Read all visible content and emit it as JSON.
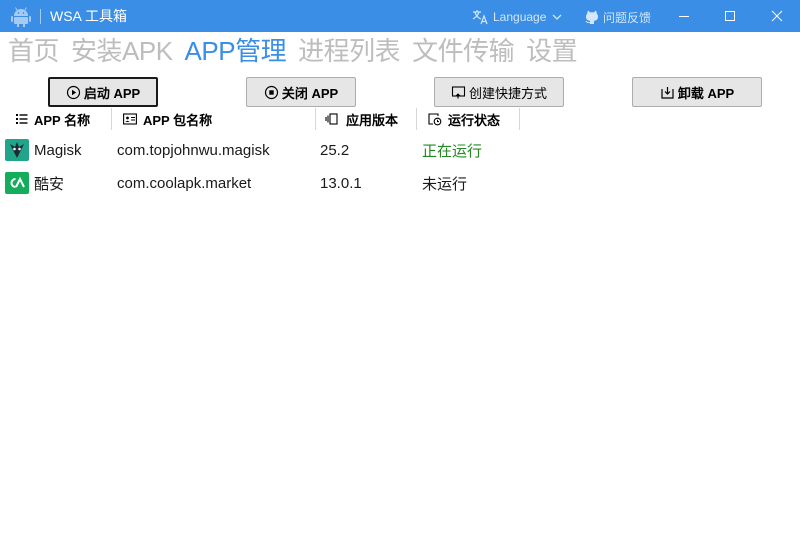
{
  "window": {
    "title": "WSA 工具箱",
    "language_label": "Language",
    "feedback_label": "问题反馈",
    "accent_color": "#3a8ee6"
  },
  "nav": {
    "items": [
      "首页",
      "安装APK",
      "APP管理",
      "进程列表",
      "文件传输",
      "设置"
    ],
    "active": "APP管理"
  },
  "toolbar": {
    "start_label": "启动 APP",
    "close_label": "关闭 APP",
    "shortcut_label": "创建快捷方式",
    "uninstall_label": "卸载 APP"
  },
  "table": {
    "columns": [
      "APP 名称",
      "APP 包名称",
      "应用版本",
      "运行状态"
    ],
    "rows": [
      {
        "name": "Magisk",
        "package": "com.topjohnwu.magisk",
        "version": "25.2",
        "status": "正在运行",
        "icon": "magisk-icon"
      },
      {
        "name": "酷安",
        "package": "com.coolapk.market",
        "version": "13.0.1",
        "status": "未运行",
        "icon": "coolapk-icon"
      }
    ],
    "running_color": "#238823"
  }
}
